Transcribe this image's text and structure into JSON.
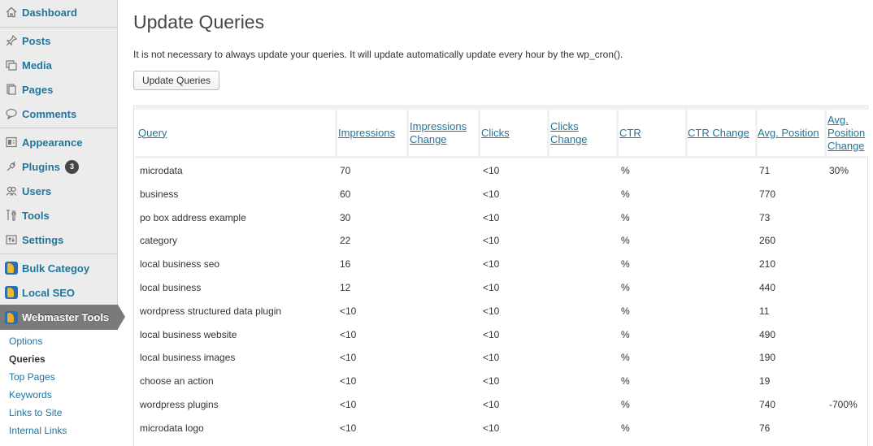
{
  "sidebar": {
    "items": [
      {
        "label": "Dashboard",
        "icon": "home-icon"
      },
      {
        "label": "Posts",
        "icon": "pin-icon"
      },
      {
        "label": "Media",
        "icon": "media-icon"
      },
      {
        "label": "Pages",
        "icon": "pages-icon"
      },
      {
        "label": "Comments",
        "icon": "comment-icon"
      },
      {
        "label": "Appearance",
        "icon": "appearance-icon"
      },
      {
        "label": "Plugins",
        "icon": "plugin-icon",
        "badge": "3"
      },
      {
        "label": "Users",
        "icon": "users-icon"
      },
      {
        "label": "Tools",
        "icon": "tools-icon"
      },
      {
        "label": "Settings",
        "icon": "settings-icon"
      },
      {
        "label": "Bulk Categoy",
        "icon": "yoast-icon"
      },
      {
        "label": "Local SEO",
        "icon": "yoast-icon"
      }
    ],
    "active": {
      "label": "Webmaster Tools",
      "icon": "yoast-icon"
    },
    "submenu": [
      {
        "label": "Options"
      },
      {
        "label": "Queries",
        "current": true
      },
      {
        "label": "Top Pages"
      },
      {
        "label": "Keywords"
      },
      {
        "label": "Links to Site"
      },
      {
        "label": "Internal Links"
      }
    ]
  },
  "main": {
    "title": "Update Queries",
    "intro": "It is not necessary to always update your queries. It will update automatically update every hour by the wp_cron().",
    "button_label": "Update Queries"
  },
  "table": {
    "headers": [
      "Query",
      "Impressions",
      "Impressions Change",
      "Clicks",
      "Clicks Change",
      "CTR",
      "CTR Change",
      "Avg. Position",
      "Avg. Position Change"
    ],
    "rows": [
      [
        "microdata",
        "70",
        "",
        "<10",
        "",
        "%",
        "",
        "71",
        "30%"
      ],
      [
        "business",
        "60",
        "",
        "<10",
        "",
        "%",
        "",
        "770",
        ""
      ],
      [
        "po box address example",
        "30",
        "",
        "<10",
        "",
        "%",
        "",
        "73",
        ""
      ],
      [
        "category",
        "22",
        "",
        "<10",
        "",
        "%",
        "",
        "260",
        ""
      ],
      [
        "local business seo",
        "16",
        "",
        "<10",
        "",
        "%",
        "",
        "210",
        ""
      ],
      [
        "local business",
        "12",
        "",
        "<10",
        "",
        "%",
        "",
        "440",
        ""
      ],
      [
        "wordpress structured data plugin",
        "<10",
        "",
        "<10",
        "",
        "%",
        "",
        "11",
        ""
      ],
      [
        "local business website",
        "<10",
        "",
        "<10",
        "",
        "%",
        "",
        "490",
        ""
      ],
      [
        "local business images",
        "<10",
        "",
        "<10",
        "",
        "%",
        "",
        "190",
        ""
      ],
      [
        "choose an action",
        "<10",
        "",
        "<10",
        "",
        "%",
        "",
        "19",
        ""
      ],
      [
        "wordpress plugins",
        "<10",
        "",
        "<10",
        "",
        "%",
        "",
        "740",
        "-700%"
      ],
      [
        "microdata logo",
        "<10",
        "",
        "<10",
        "",
        "%",
        "",
        "76",
        ""
      ]
    ]
  },
  "colors": {
    "link": "#21759b",
    "sidebar_bg": "#ececec",
    "active_menu_bg": "#7a7a7a",
    "header_bg": "#f1f1f1"
  }
}
